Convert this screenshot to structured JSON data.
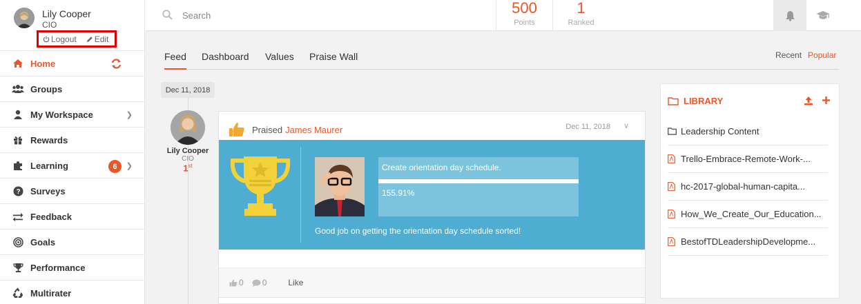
{
  "user": {
    "name": "Lily Cooper",
    "role": "CIO",
    "logout_label": "Logout",
    "edit_label": "Edit"
  },
  "nav": {
    "items": [
      {
        "label": "Home",
        "icon": "home-icon",
        "active": true
      },
      {
        "label": "Groups",
        "icon": "users-icon"
      },
      {
        "label": "My Workspace",
        "icon": "user-icon"
      },
      {
        "label": "Rewards",
        "icon": "gift-icon"
      },
      {
        "label": "Learning",
        "icon": "puzzle-icon",
        "badge": "6"
      },
      {
        "label": "Surveys",
        "icon": "question-icon"
      },
      {
        "label": "Feedback",
        "icon": "exchange-icon"
      },
      {
        "label": "Goals",
        "icon": "target-icon"
      },
      {
        "label": "Performance",
        "icon": "trophy-icon"
      },
      {
        "label": "Multirater",
        "icon": "recycle-icon"
      }
    ]
  },
  "search": {
    "placeholder": "Search"
  },
  "stats": {
    "points_value": "500",
    "points_label": "Points",
    "ranked_value": "1",
    "ranked_label": "Ranked"
  },
  "tabs": [
    "Feed",
    "Dashboard",
    "Values",
    "Praise Wall"
  ],
  "sort": {
    "recent": "Recent",
    "popular": "Popular"
  },
  "feed": {
    "date_group": "Dec 11, 2018",
    "poster": {
      "name": "Lily Cooper",
      "role": "CIO",
      "rank_num": "1",
      "rank_suffix": "st"
    },
    "post": {
      "action": "Praised",
      "target": "James Maurer",
      "date": "Dec 11, 2018",
      "goal_title": "Create orientation day schedule.",
      "goal_percent": "155.91%",
      "progress_fraction": 1.0,
      "message": "Good job on getting the orientation day schedule sorted!",
      "likes": "0",
      "comments": "0",
      "like_label": "Like"
    }
  },
  "library": {
    "title": "LIBRARY",
    "items": [
      {
        "name": "Leadership Content",
        "type": "folder"
      },
      {
        "name": "Trello-Embrace-Remote-Work-...",
        "type": "pdf"
      },
      {
        "name": "hc-2017-global-human-capita...",
        "type": "pdf"
      },
      {
        "name": "How_We_Create_Our_Education...",
        "type": "pdf"
      },
      {
        "name": "BestofTDLeadershipDevelopme...",
        "type": "pdf"
      }
    ]
  },
  "colors": {
    "accent": "#e8562a",
    "praise_bg": "#4eadd0",
    "trophy": "#f3d13b"
  }
}
